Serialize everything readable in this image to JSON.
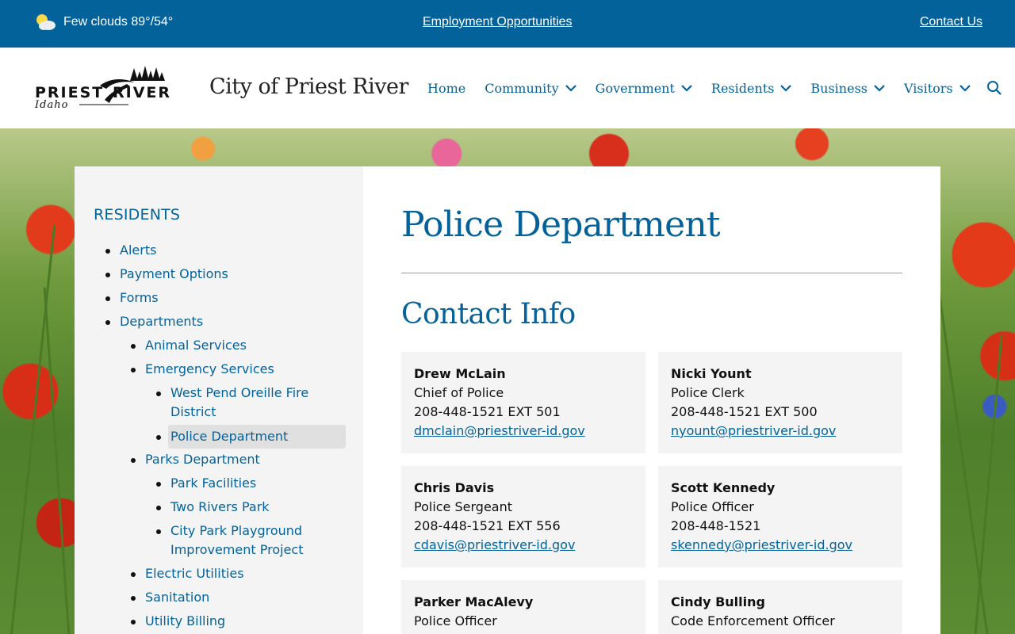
{
  "topbar": {
    "weather_text": "Few clouds 89°/54°",
    "employment_link": "Employment Opportunities",
    "contact_link": "Contact Us"
  },
  "header": {
    "logo_text_main": "PRIEST RIVER",
    "logo_text_sub": "Idaho",
    "site_title": "City of Priest River",
    "nav": [
      {
        "label": "Home",
        "has_menu": false
      },
      {
        "label": "Community",
        "has_menu": true
      },
      {
        "label": "Government",
        "has_menu": true
      },
      {
        "label": "Residents",
        "has_menu": true
      },
      {
        "label": "Business",
        "has_menu": true
      },
      {
        "label": "Visitors",
        "has_menu": true
      }
    ]
  },
  "sidebar": {
    "heading": "RESIDENTS",
    "items": [
      {
        "label": "Alerts"
      },
      {
        "label": "Payment Options"
      },
      {
        "label": "Forms"
      },
      {
        "label": "Departments"
      },
      {
        "label": "Animal Services"
      },
      {
        "label": "Emergency Services"
      },
      {
        "label": "West Pend Oreille Fire",
        "label2": "District"
      },
      {
        "label": "Police Department"
      },
      {
        "label": "Parks Department"
      },
      {
        "label": "Park Facilities"
      },
      {
        "label": "Two Rivers Park"
      },
      {
        "label": "City Park Playground",
        "label2": "Improvement Project"
      },
      {
        "label": "Electric Utilities"
      },
      {
        "label": "Sanitation"
      },
      {
        "label": "Utility Billing"
      }
    ]
  },
  "main": {
    "page_title": "Police Department",
    "section_title": "Contact Info",
    "contacts": [
      {
        "name": "Drew McLain",
        "title": "Chief of Police",
        "phone": "208-448-1521 EXT 501",
        "email": "dmclain@priestriver-id.gov"
      },
      {
        "name": "Nicki Yount",
        "title": "Police Clerk",
        "phone": "208-448-1521 EXT 500",
        "email": "nyount@priestriver-id.gov"
      },
      {
        "name": "Chris Davis",
        "title": "Police Sergeant",
        "phone": "208-448-1521 EXT 556",
        "email": "cdavis@priestriver-id.gov"
      },
      {
        "name": "Scott Kennedy",
        "title": "Police Officer",
        "phone": "208-448-1521",
        "email": "skennedy@priestriver-id.gov"
      },
      {
        "name": "Parker MacAlevy",
        "title": "Police Officer",
        "phone": "",
        "email": ""
      },
      {
        "name": "Cindy Bulling",
        "title": "Code Enforcement Officer",
        "phone": "",
        "email": ""
      }
    ]
  },
  "colors": {
    "brand_blue": "#04629a",
    "sidebar_bg": "#f4f4f4",
    "card_bg": "#f4f4f4"
  },
  "icons": {
    "weather": "partly-cloudy-icon",
    "nav_menu": "chevron-down-icon",
    "search": "search-icon"
  }
}
